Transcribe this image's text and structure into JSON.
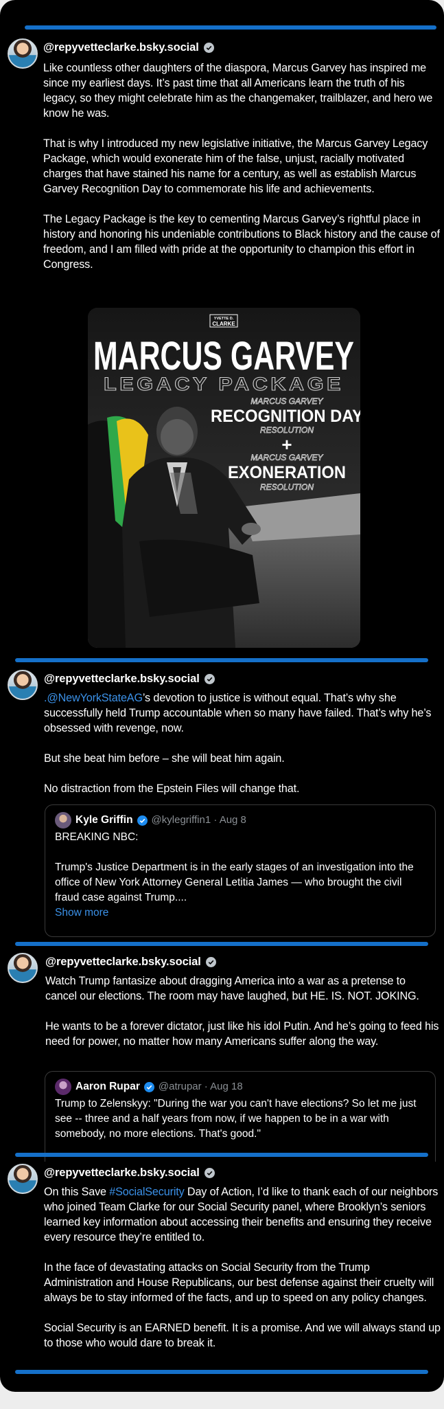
{
  "posts": [
    {
      "handle": "@repyvetteclarke.bsky.social",
      "paragraphs": [
        "Like countless other daughters of the diaspora, Marcus Garvey has inspired me since my earliest days. It’s past time that all Americans learn the truth of his legacy, so they might celebrate him as the changemaker, trailblazer, and hero we know he was.",
        "That is why I introduced my new legislative initiative, the Marcus Garvey Legacy Package, which would exonerate him of the false, unjust, racially motivated charges that have stained his name for a century, as well as establish Marcus Garvey Recognition Day to commemorate his life and achievements.",
        "The Legacy Package is the key to cementing Marcus Garvey’s rightful place in history and honoring his undeniable contributions to Black history and the cause of freedom, and I am filled with pride at the opportunity to champion this effort in Congress."
      ],
      "image": {
        "logo_line1": "YVETTE D.",
        "logo_line2": "CLARKE",
        "title": "MARCUS GARVEY",
        "subtitle": "LEGACY PACKAGE",
        "line1_small": "MARCUS GARVEY",
        "line1_big": "RECOGNITION DAY",
        "line1_tail": "RESOLUTION",
        "plus": "+",
        "line2_small": "MARCUS GARVEY",
        "line2_big": "EXONERATION",
        "line2_tail": "RESOLUTION"
      }
    },
    {
      "handle": "@repyvetteclarke.bsky.social",
      "mention": ".@NewYorkStateAG",
      "p1_rest": "’s devotion to justice is without equal. That’s why she successfully held Trump accountable when so many have failed. That’s why he’s obsessed with revenge, now.",
      "p2": "But she beat him before – she will beat him again.",
      "p3": "No distraction from the Epstein Files will change that.",
      "quote": {
        "name": "Kyle Griffin",
        "meta": "@kylegriffin1 · Aug 8",
        "p1": "BREAKING NBC:",
        "p2": "Trump's Justice Department is in the early stages of an investigation into the office of New York Attorney General Letitia James — who brought the civil fraud case against Trump....",
        "show_more": "Show more"
      }
    },
    {
      "handle": "@repyvetteclarke.bsky.social",
      "p1": "Watch Trump fantasize about dragging America into a war as a pretense to cancel our elections. The room may have laughed, but HE. IS. NOT. JOKING.",
      "p2": "He wants to be a forever dictator, just like his idol Putin. And he’s going to feed his need for power, no matter how many Americans suffer along the way.",
      "quote": {
        "name": "Aaron Rupar",
        "meta": "@atrupar · Aug 18",
        "p1": "Trump to Zelenskyy: \"During the war you can't have elections? So let me just see -- three and a half years from now, if we happen to be in a war with somebody, no more elections. That's good.\""
      }
    },
    {
      "handle": "@repyvetteclarke.bsky.social",
      "p1_pre": "On this Save ",
      "hashtag": "#SocialSecurity",
      "p1_rest": " Day of Action, I’d like to thank each of our neighbors who joined Team Clarke for our Social Security panel, where Brooklyn’s seniors learned key information about accessing their benefits and ensuring they receive every resource they’re entitled to.",
      "p2": "In the face of devastating attacks on Social Security from the Trump Administration and House Republicans, our best defense against their cruelty will always be to stay informed of the facts, and up to speed on any policy changes.",
      "p3": "Social Security is an EARNED benefit. It is a promise. And we will always stand up to those who would dare to break it."
    }
  ],
  "colors": {
    "background": "#000000",
    "divider": "#1570c9",
    "link": "#3b91e8",
    "verified_gray": "#bfc6cc",
    "verified_blue": "#1d8cf0"
  },
  "icons": {
    "verified": "verified-check-icon"
  }
}
